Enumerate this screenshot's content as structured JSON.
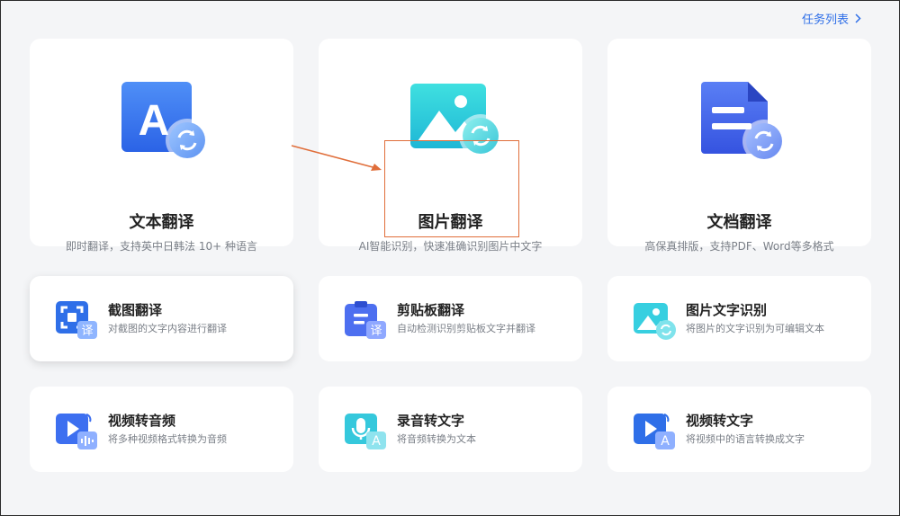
{
  "header": {
    "task_list_label": "任务列表"
  },
  "big_cards": [
    {
      "title": "文本翻译",
      "desc": "即时翻译，支持英中日韩法 10+ 种语言"
    },
    {
      "title": "图片翻译",
      "desc": "AI智能识别，快速准确识别图片中文字"
    },
    {
      "title": "文档翻译",
      "desc": "高保真排版，支持PDF、Word等多格式"
    }
  ],
  "small_cards": [
    {
      "title": "截图翻译",
      "desc": "对截图的文字内容进行翻译",
      "badge": "译"
    },
    {
      "title": "剪贴板翻译",
      "desc": "自动检测识别剪贴板文字并翻译",
      "badge": "译"
    },
    {
      "title": "图片文字识别",
      "desc": "将图片的文字识别为可编辑文本"
    },
    {
      "title": "视频转音频",
      "desc": "将多种视频格式转换为音频"
    },
    {
      "title": "录音转文字",
      "desc": "将音频转换为文本",
      "badge": "A"
    },
    {
      "title": "视频转文字",
      "desc": "将视频中的语言转换成文字",
      "badge": "A"
    }
  ],
  "icons": {
    "text_letter": "A",
    "names": [
      "text-translate-icon",
      "image-translate-icon",
      "document-translate-icon",
      "screenshot-icon",
      "clipboard-icon",
      "image-ocr-icon",
      "video-audio-icon",
      "recording-icon",
      "video-text-icon"
    ]
  },
  "colors": {
    "accent": "#2f6fe8",
    "annotation": "#e06e3a",
    "text_primary": "#222222",
    "text_secondary": "#7a7f87"
  }
}
